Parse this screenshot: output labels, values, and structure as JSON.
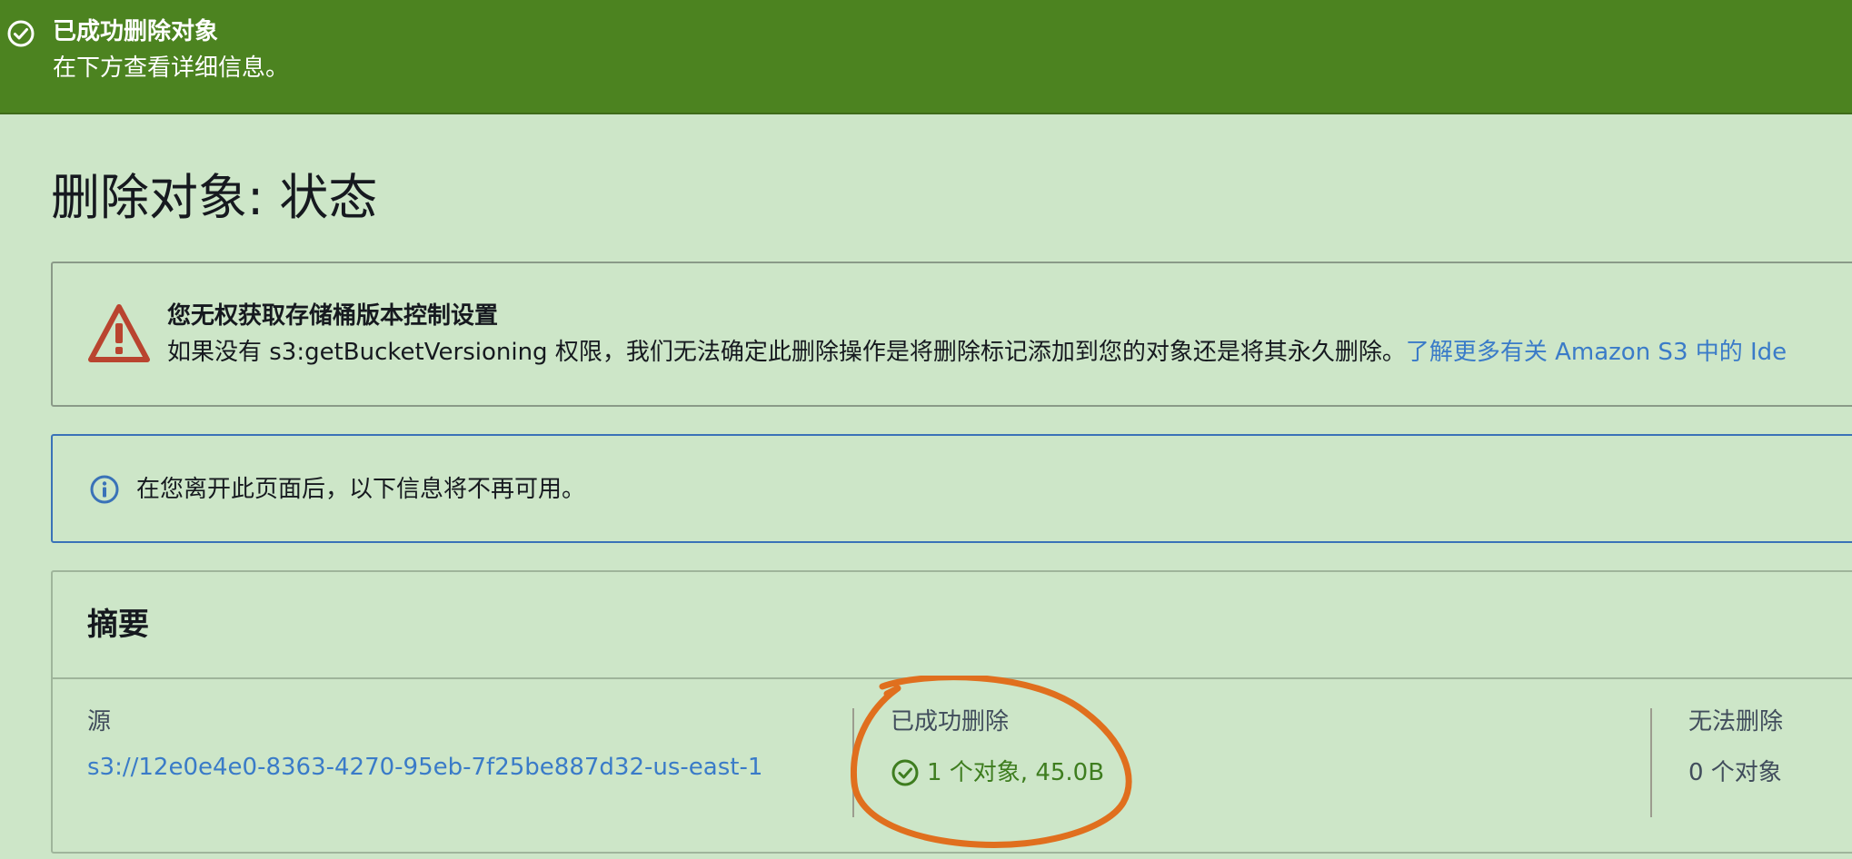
{
  "flash": {
    "title": "已成功删除对象",
    "description": "在下方查看详细信息。",
    "icon": "check-circle-icon",
    "color": "#4c8320"
  },
  "page": {
    "title": "删除对象: 状态"
  },
  "warning": {
    "icon": "warning-triangle-icon",
    "title": "您无权获取存储桶版本控制设置",
    "description": "如果没有 s3:getBucketVersioning 权限，我们无法确定此删除操作是将删除标记添加到您的对象还是将其永久删除。",
    "link_text": "了解更多有关 Amazon S3 中的 Ide",
    "color": "#b9442f"
  },
  "info": {
    "icon": "info-circle-icon",
    "text": "在您离开此页面后，以下信息将不再可用。"
  },
  "summary": {
    "title": "摘要",
    "source": {
      "label": "源",
      "value": "s3://12e0e4e0-8363-4270-95eb-7f25be887d32-us-east-1"
    },
    "succeeded": {
      "label": "已成功删除",
      "value": "1 个对象, 45.0B",
      "icon": "check-circle-icon",
      "color": "#3e7d1f"
    },
    "failed": {
      "label": "无法删除",
      "value": "0 个对象"
    }
  },
  "annotation": {
    "color": "#e06f1e"
  }
}
